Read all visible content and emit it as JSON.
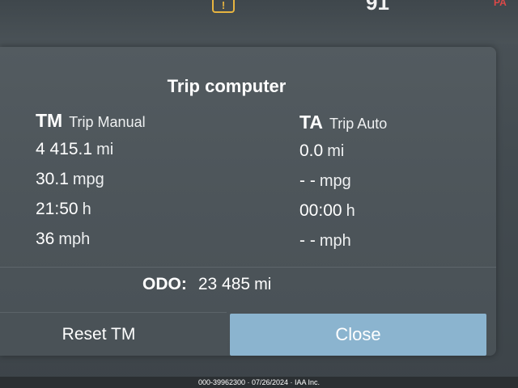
{
  "status": {
    "warning_icon_glyph": "!",
    "temperature_fragment": "91",
    "right_fragment": "PA"
  },
  "dialog": {
    "title": "Trip computer",
    "trip_manual": {
      "abbr": "TM",
      "name": "Trip Manual",
      "distance": "4 415.1",
      "distance_unit": "mi",
      "economy": "30.1",
      "economy_unit": "mpg",
      "time": "21:50",
      "time_unit": "h",
      "speed": "36",
      "speed_unit": "mph"
    },
    "trip_auto": {
      "abbr": "TA",
      "name": "Trip Auto",
      "distance": "0.0",
      "distance_unit": "mi",
      "economy": "- -",
      "economy_unit": "mpg",
      "time": "00:00",
      "time_unit": "h",
      "speed": "- -",
      "speed_unit": "mph"
    },
    "odometer": {
      "label": "ODO:",
      "value": "23 485",
      "unit": "mi"
    },
    "reset_label": "Reset TM",
    "close_label": "Close"
  },
  "footer_text": "000-39962300 · 07/26/2024 · IAA Inc.",
  "colors": {
    "close_button": "#8bb4cf",
    "warning_icon": "#e7b440",
    "panel": "#4d555a"
  }
}
